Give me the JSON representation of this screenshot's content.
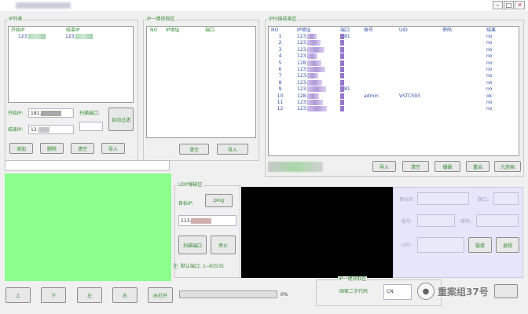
{
  "window": {
    "minimize": "–",
    "maximize": "□",
    "close": "✕"
  },
  "ip_list": {
    "title": "IP列表",
    "headers": [
      "开始IP",
      "结束IP"
    ],
    "row": {
      "start": "123.",
      "end": "123."
    },
    "start_label": "开始IP:",
    "start_value": "181.",
    "end_label": "结束IP:",
    "end_value": "12.",
    "scan_port_label": "扫描端口:",
    "auto_filter": "自动过滤",
    "buttons": {
      "add": "添加",
      "delete": "删除",
      "clear": "清空",
      "import": "导入"
    }
  },
  "ip_one_key": {
    "title": "IP一键获取区",
    "headers": [
      "NO",
      "IP地址",
      "端口"
    ],
    "buttons": {
      "clear": "清空",
      "import": "导入"
    }
  },
  "scan_result": {
    "title": "IP扫描结果区",
    "headers": [
      "NO",
      "IP地址",
      "端口",
      "账号",
      "UID",
      "密码",
      "结果"
    ],
    "rows": [
      {
        "no": "1",
        "ip": "123.",
        "port": "81",
        "account": "",
        "uid": "",
        "result": "no"
      },
      {
        "no": "2",
        "ip": "123.",
        "port": "",
        "account": "",
        "uid": "",
        "result": "no"
      },
      {
        "no": "3",
        "ip": "123.",
        "port": "",
        "account": "",
        "uid": "",
        "result": "no"
      },
      {
        "no": "4",
        "ip": "123.",
        "port": "",
        "account": "",
        "uid": "",
        "result": "no"
      },
      {
        "no": "5",
        "ip": "128.",
        "port": "",
        "account": "",
        "uid": "",
        "result": "no"
      },
      {
        "no": "6",
        "ip": "123.",
        "port": "",
        "account": "",
        "uid": "",
        "result": "no"
      },
      {
        "no": "7",
        "ip": "123.",
        "port": "",
        "account": "",
        "uid": "",
        "result": "no"
      },
      {
        "no": "8",
        "ip": "123.",
        "port": "",
        "account": "",
        "uid": "",
        "result": "no"
      },
      {
        "no": "9",
        "ip": "123.",
        "port": "81",
        "account": "",
        "uid": "",
        "result": "no"
      },
      {
        "no": "10",
        "ip": "128.",
        "port": "",
        "account": "admin",
        "uid": "VSTC593",
        "result": "ok"
      },
      {
        "no": "11",
        "ip": "123.",
        "port": "",
        "account": "",
        "uid": "",
        "result": "no"
      },
      {
        "no": "12",
        "ip": "123.",
        "port": "",
        "account": "",
        "uid": "",
        "result": "no"
      }
    ],
    "buttons": {
      "import": "导入",
      "clear": "清空",
      "explode": "爆破",
      "reset": "重启",
      "nine_screen": "九宫画"
    }
  },
  "udp": {
    "title": "UDP爆破区",
    "target_ip_label": "目标IP:",
    "ping": "ping",
    "target_ip_value": "113.",
    "scan_port": "扫描端口",
    "stop": "停止",
    "note": "注: 默认端口: 1--65535"
  },
  "target_panel": {
    "target_ip_label": "目标IP:",
    "port_label": "端口:",
    "account_label": "账号:",
    "password_label": "密码:",
    "uid_label": "UID:",
    "connect": "链接",
    "exit": "退视"
  },
  "bottom": {
    "up": "上",
    "down": "下",
    "left": "左",
    "right": "右",
    "ir": "IR打开",
    "progress_percent": 0,
    "progress_text": "0%"
  },
  "ip_acquire": {
    "title": "IP一键获取区",
    "label": "国家二字代码",
    "value": "CN"
  },
  "watermark": {
    "text": "重案组37号"
  },
  "colors": {
    "green_panel": "#8cff8c",
    "video_black": "#000000",
    "lavender": "#e6e6fa",
    "label_green": "#2c8a2c"
  }
}
